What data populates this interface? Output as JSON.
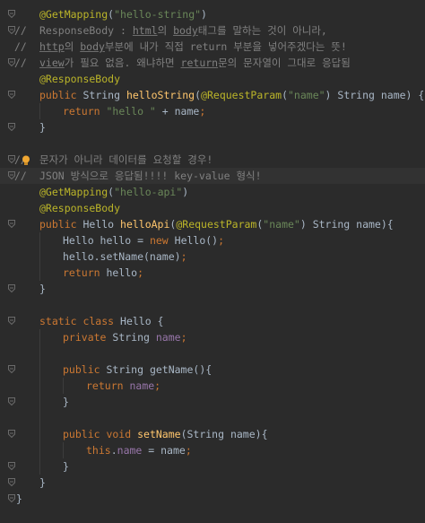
{
  "lines": [
    {
      "t": [
        [
          "@GetMapping",
          "ann"
        ],
        [
          "(",
          ""
        ],
        [
          "\"hello-string\"",
          "str"
        ],
        [
          ")",
          ""
        ]
      ]
    },
    {
      "c": "//",
      "t": [
        [
          "ResponseBody : ",
          "dim"
        ],
        [
          "html",
          "dim ul"
        ],
        [
          "의 ",
          "dim"
        ],
        [
          "body",
          "dim ul"
        ],
        [
          "태그를 말하는 것이 아니라,",
          "dim"
        ]
      ]
    },
    {
      "c": "//",
      "t": [
        [
          "http",
          "dim ul"
        ],
        [
          "의 ",
          "dim"
        ],
        [
          "body",
          "dim ul"
        ],
        [
          "부분에 내가 직접 return 부분을 넣어주겠다는 뜻!",
          "dim"
        ]
      ]
    },
    {
      "c": "//",
      "t": [
        [
          "view",
          "dim ul"
        ],
        [
          "가 필요 없음. 왜냐하면 ",
          "dim"
        ],
        [
          "return",
          "dim ul"
        ],
        [
          "문의 문자열이 그대로 응답됨",
          "dim"
        ]
      ]
    },
    {
      "t": [
        [
          "@ResponseBody",
          "ann"
        ]
      ]
    },
    {
      "t": [
        [
          "public ",
          "kw"
        ],
        [
          "String ",
          ""
        ],
        [
          "helloString",
          "fn"
        ],
        [
          "(",
          ""
        ],
        [
          "@RequestParam",
          "ann"
        ],
        [
          "(",
          ""
        ],
        [
          "\"name\"",
          "str"
        ],
        [
          ") String name) {",
          ""
        ]
      ]
    },
    {
      "i": 1,
      "t": [
        [
          "return ",
          "kw"
        ],
        [
          "\"hello \"",
          "str"
        ],
        [
          " + name",
          ""
        ],
        [
          ";",
          "kw"
        ]
      ]
    },
    {
      "t": [
        [
          "}",
          ""
        ]
      ]
    },
    {
      "t": []
    },
    {
      "c": "//",
      "bulb": true,
      "t": [
        [
          "문자가 아니라 데이터를 요청할 경우!",
          "dim"
        ]
      ]
    },
    {
      "c": "//",
      "hl": true,
      "t": [
        [
          "JSON 방식으로 응답됨!!!! key-value 형식!",
          "dim"
        ]
      ]
    },
    {
      "t": [
        [
          "@GetMapping",
          "ann"
        ],
        [
          "(",
          ""
        ],
        [
          "\"hello-api\"",
          "str"
        ],
        [
          ")",
          ""
        ]
      ]
    },
    {
      "t": [
        [
          "@ResponseBody",
          "ann"
        ]
      ]
    },
    {
      "t": [
        [
          "public ",
          "kw"
        ],
        [
          "Hello ",
          ""
        ],
        [
          "helloApi",
          "fn"
        ],
        [
          "(",
          ""
        ],
        [
          "@RequestParam",
          "ann"
        ],
        [
          "(",
          ""
        ],
        [
          "\"name\"",
          "str"
        ],
        [
          ") String name){",
          ""
        ]
      ]
    },
    {
      "i": 1,
      "t": [
        [
          "Hello hello = ",
          ""
        ],
        [
          "new ",
          "kw"
        ],
        [
          "Hello()",
          ""
        ],
        [
          ";",
          "kw"
        ]
      ]
    },
    {
      "i": 1,
      "t": [
        [
          "hello.setName(name)",
          ""
        ],
        [
          ";",
          "kw"
        ]
      ]
    },
    {
      "i": 1,
      "t": [
        [
          "return ",
          "kw"
        ],
        [
          "hello",
          ""
        ],
        [
          ";",
          "kw"
        ]
      ]
    },
    {
      "t": [
        [
          "}",
          ""
        ]
      ]
    },
    {
      "t": []
    },
    {
      "t": [
        [
          "static class ",
          "kw"
        ],
        [
          "Hello {",
          ""
        ]
      ]
    },
    {
      "i": 1,
      "t": [
        [
          "private ",
          "kw"
        ],
        [
          "String ",
          ""
        ],
        [
          "name",
          "fld"
        ],
        [
          ";",
          "kw"
        ]
      ]
    },
    {
      "t": []
    },
    {
      "i": 1,
      "t": [
        [
          "public ",
          "kw"
        ],
        [
          "String ",
          ""
        ],
        [
          "getName",
          ""
        ],
        [
          "(){",
          ""
        ]
      ]
    },
    {
      "i": 2,
      "t": [
        [
          "return ",
          "kw"
        ],
        [
          "name",
          "fld"
        ],
        [
          ";",
          "kw"
        ]
      ]
    },
    {
      "i": 1,
      "t": [
        [
          "}",
          ""
        ]
      ]
    },
    {
      "t": []
    },
    {
      "i": 1,
      "t": [
        [
          "public void ",
          "kw"
        ],
        [
          "setName",
          "fn"
        ],
        [
          "(String name){",
          ""
        ]
      ]
    },
    {
      "i": 2,
      "t": [
        [
          "this",
          "kw"
        ],
        [
          ".",
          ""
        ],
        [
          "name",
          "fld"
        ],
        [
          " = name",
          ""
        ],
        [
          ";",
          "kw"
        ]
      ]
    },
    {
      "i": 1,
      "t": [
        [
          "}",
          ""
        ]
      ]
    },
    {
      "t": [
        [
          "}",
          ""
        ]
      ]
    },
    {
      "o": -1,
      "t": [
        [
          "}",
          ""
        ]
      ]
    }
  ],
  "folds": [
    0,
    1,
    3,
    5,
    7,
    9,
    10,
    13,
    17,
    19,
    22,
    24,
    26,
    28,
    29,
    30
  ],
  "colors": {
    "background": "#2b2b2b",
    "annotation": "#bbb529",
    "string": "#6a8759",
    "keyword": "#cc7832",
    "field": "#9876aa",
    "function": "#ffc66d",
    "comment": "#808080",
    "text": "#a9b7c6"
  }
}
